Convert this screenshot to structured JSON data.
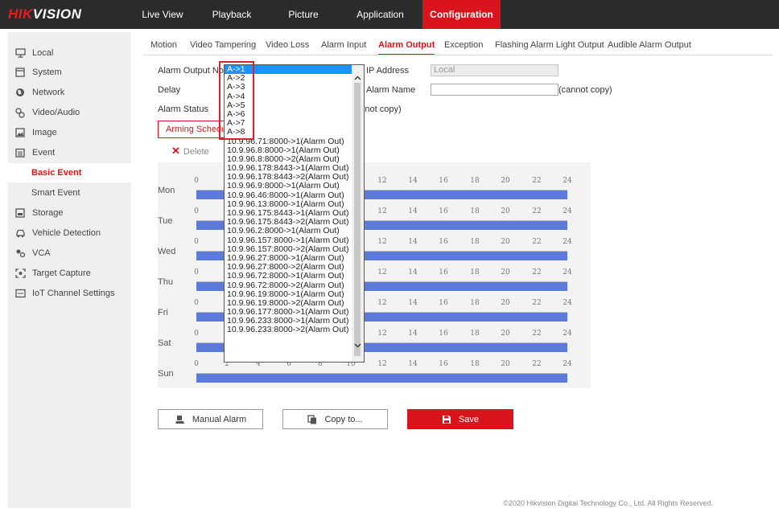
{
  "logo": {
    "brand_red": "HIK",
    "brand_rest": "VISION"
  },
  "colors": {
    "accent": "#d9141c",
    "topbar": "#2b2b2b",
    "schedule_bar": "#5b7ad9",
    "dropdown_selected": "#1e90ff",
    "highlight_box": "#e0202a"
  },
  "topnav": {
    "items": [
      {
        "label": "Live View",
        "active": false
      },
      {
        "label": "Playback",
        "active": false
      },
      {
        "label": "Picture",
        "active": false
      },
      {
        "label": "Application",
        "active": false
      },
      {
        "label": "Configuration",
        "active": true
      }
    ]
  },
  "sidebar": {
    "items": [
      {
        "label": "Local",
        "icon": "monitor-icon"
      },
      {
        "label": "System",
        "icon": "system-icon"
      },
      {
        "label": "Network",
        "icon": "globe-icon"
      },
      {
        "label": "Video/Audio",
        "icon": "camera-icon"
      },
      {
        "label": "Image",
        "icon": "image-icon"
      },
      {
        "label": "Event",
        "icon": "calendar-icon"
      },
      {
        "label": "Basic Event",
        "sub": true,
        "active": true
      },
      {
        "label": "Smart Event",
        "sub": true
      },
      {
        "label": "Storage",
        "icon": "storage-icon"
      },
      {
        "label": "Vehicle Detection",
        "icon": "car-icon"
      },
      {
        "label": "VCA",
        "icon": "vca-icon"
      },
      {
        "label": "Target Capture",
        "icon": "target-capture-icon"
      },
      {
        "label": "IoT Channel Settings",
        "icon": "iot-icon"
      }
    ]
  },
  "subtabs": [
    {
      "label": "Motion",
      "active": false
    },
    {
      "label": "Video Tampering",
      "active": false
    },
    {
      "label": "Video Loss",
      "active": false
    },
    {
      "label": "Alarm Input",
      "active": false
    },
    {
      "label": "Alarm Output",
      "active": true
    },
    {
      "label": "Exception",
      "active": false
    },
    {
      "label": "Flashing Alarm Light Output",
      "active": false
    },
    {
      "label": "Audible Alarm Output",
      "active": false
    }
  ],
  "form": {
    "alarm_output_no_label": "Alarm Output No.",
    "delay_label": "Delay",
    "alarm_status_label": "Alarm Status",
    "ip_address_label": "IP Address",
    "ip_address_value": "Local",
    "alarm_name_label": "Alarm Name",
    "alarm_name_value": "",
    "cannot_copy_1": "(cannot copy)",
    "cannot_copy_2": "(cannot copy)"
  },
  "arming": {
    "tab_label": "Arming Schedule",
    "delete_label": "Delete"
  },
  "schedule": {
    "ticks": [
      "0",
      "2",
      "4",
      "6",
      "8",
      "10",
      "12",
      "14",
      "16",
      "18",
      "20",
      "22",
      "24"
    ],
    "days": [
      "Mon",
      "Tue",
      "Wed",
      "Thu",
      "Fri",
      "Sat",
      "Sun"
    ],
    "full_day_armed": true
  },
  "buttons": {
    "manual_alarm": "Manual Alarm",
    "copy_to": "Copy to...",
    "save": "Save"
  },
  "dropdown": {
    "selected": "A->1",
    "options": [
      "A->1",
      "A->2",
      "A->3",
      "A->4",
      "A->5",
      "A->6",
      "A->7",
      "A->8",
      "10.9.96.71:8000->1(Alarm Out)",
      "10.9.96.8:8000->1(Alarm Out)",
      "10.9.96.8:8000->2(Alarm Out)",
      "10.9.96.178:8443->1(Alarm Out)",
      "10.9.96.178:8443->2(Alarm Out)",
      "10.9.96.9:8000->1(Alarm Out)",
      "10.9.96.46:8000->1(Alarm Out)",
      "10.9.96.13:8000->1(Alarm Out)",
      "10.9.96.175:8443->1(Alarm Out)",
      "10.9.96.175:8443->2(Alarm Out)",
      "10.9.96.2:8000->1(Alarm Out)",
      "10.9.96.157:8000->1(Alarm Out)",
      "10.9.96.157:8000->2(Alarm Out)",
      "10.9.96.27:8000->1(Alarm Out)",
      "10.9.96.27:8000->2(Alarm Out)",
      "10.9.96.72:8000->1(Alarm Out)",
      "10.9.96.72:8000->2(Alarm Out)",
      "10.9.96.19:8000->1(Alarm Out)",
      "10.9.96.19:8000->2(Alarm Out)",
      "10.9.96.177:8000->1(Alarm Out)",
      "10.9.96.233:8000->1(Alarm Out)",
      "10.9.96.233:8000->2(Alarm Out)"
    ]
  },
  "footer": {
    "copyright": "©2020 Hikvision Digital Technology Co., Ltd. All Rights Reserved."
  }
}
